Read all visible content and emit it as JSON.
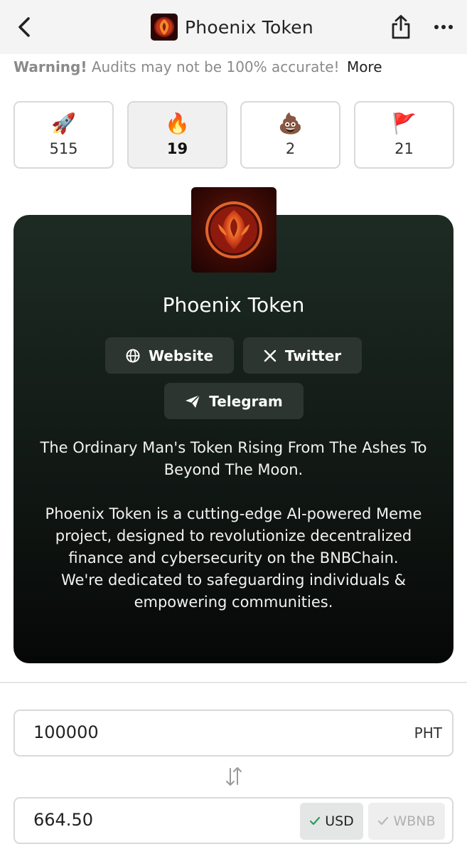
{
  "header": {
    "title": "Phoenix Token",
    "back_icon": "chevron-left-icon",
    "share_icon": "share-icon",
    "more_icon": "more-dots-icon"
  },
  "warning": {
    "label": "Warning!",
    "text": " Audits may not be 100% accurate! ",
    "more": "More"
  },
  "stats": [
    {
      "emoji": "🚀",
      "count": "515"
    },
    {
      "emoji": "🔥",
      "count": "19"
    },
    {
      "emoji": "💩",
      "count": "2"
    },
    {
      "emoji": "🚩",
      "count": "21"
    }
  ],
  "token": {
    "name": "Phoenix Token",
    "links": {
      "website": "Website",
      "twitter": "Twitter",
      "telegram": "Telegram"
    },
    "description": {
      "tagline": "The Ordinary Man's Token Rising From The Ashes To Beyond The Moon.",
      "body": "Phoenix Token is a cutting-edge AI-powered Meme project, designed to revolutionize decentralized finance and cybersecurity on the BNBChain.",
      "mission": "We're dedicated to safeguarding individuals & empowering communities."
    }
  },
  "converter": {
    "amount": "100000",
    "amount_unit": "PHT",
    "result": "664.50",
    "currencies": [
      {
        "label": "USD",
        "selected": true
      },
      {
        "label": "WBNB",
        "selected": false
      }
    ]
  },
  "colors": {
    "card_top": "#1d2b24",
    "card_bottom": "#060807",
    "link_button": "#2c3530",
    "check_green": "#2e9a5c"
  }
}
